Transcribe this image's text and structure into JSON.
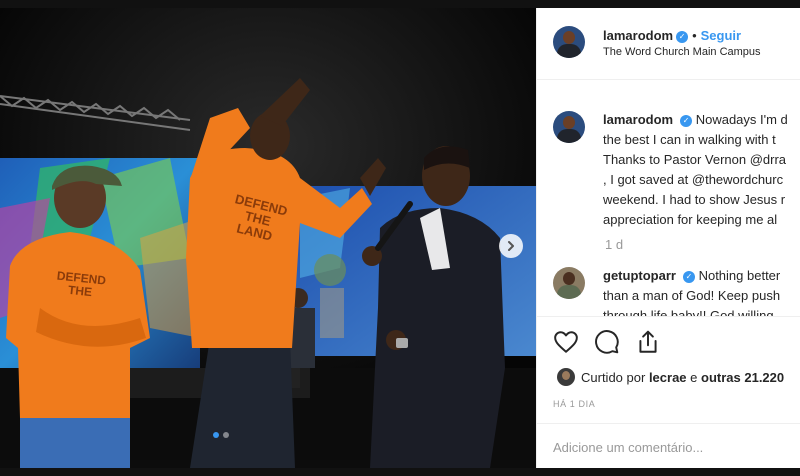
{
  "post": {
    "username": "lamarodom",
    "follow_label": "Seguir",
    "location": "The Word Church Main Campus"
  },
  "caption": {
    "username": "lamarodom",
    "lines": [
      "Nowadays I'm d",
      "the best I can in walking with t",
      "Thanks to Pastor Vernon @drra",
      ", I got saved at @thewordchurc",
      "weekend. I had to show Jesus r",
      "appreciation for keeping me al"
    ],
    "age": "1 d"
  },
  "comment": {
    "username": "getuptoparr",
    "lines": [
      "Nothing better",
      "than a man of God! Keep push",
      "through life baby!! God willing"
    ]
  },
  "likes": {
    "prefix": "Curtido por",
    "user": "lecrae",
    "middle": "e",
    "others": "outras 21.220"
  },
  "date_label": "HÁ 1 DIA",
  "add_comment_placeholder": "Adicione um comentário...",
  "photo": {
    "shirt_text": [
      "DEFEND",
      "THE",
      "LAND"
    ],
    "carousel_index": 1,
    "carousel_total": 2
  },
  "icons": {
    "like": "heart-icon",
    "comment": "comment-icon",
    "share": "share-icon",
    "verified": "verified-icon",
    "next": "chevron-right-icon"
  },
  "colors": {
    "link": "#3897f0",
    "text": "#262626",
    "muted": "#999999",
    "hoodie": "#f07b1c"
  }
}
